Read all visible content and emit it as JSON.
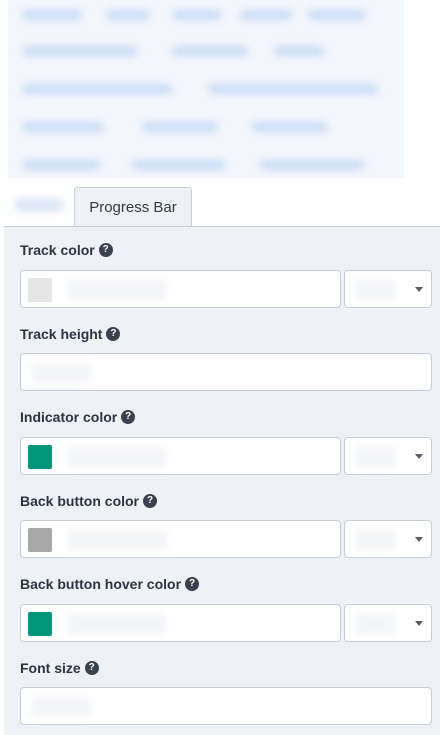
{
  "tabs": {
    "active_label": "Progress Bar"
  },
  "fields": [
    {
      "label": "Track color",
      "help": "?",
      "swatch": "#e6e6e6"
    },
    {
      "label": "Track height",
      "help": "?"
    },
    {
      "label": "Indicator color",
      "help": "?",
      "swatch": "#00977c"
    },
    {
      "label": "Back button color",
      "help": "?",
      "swatch": "#a8a8a8"
    },
    {
      "label": "Back button hover color",
      "help": "?",
      "swatch": "#00977c"
    },
    {
      "label": "Font size",
      "help": "?"
    }
  ],
  "colors": {
    "panel_bg": "#eef1f6",
    "border": "#c9cfd7",
    "label_text": "#2b3440"
  }
}
